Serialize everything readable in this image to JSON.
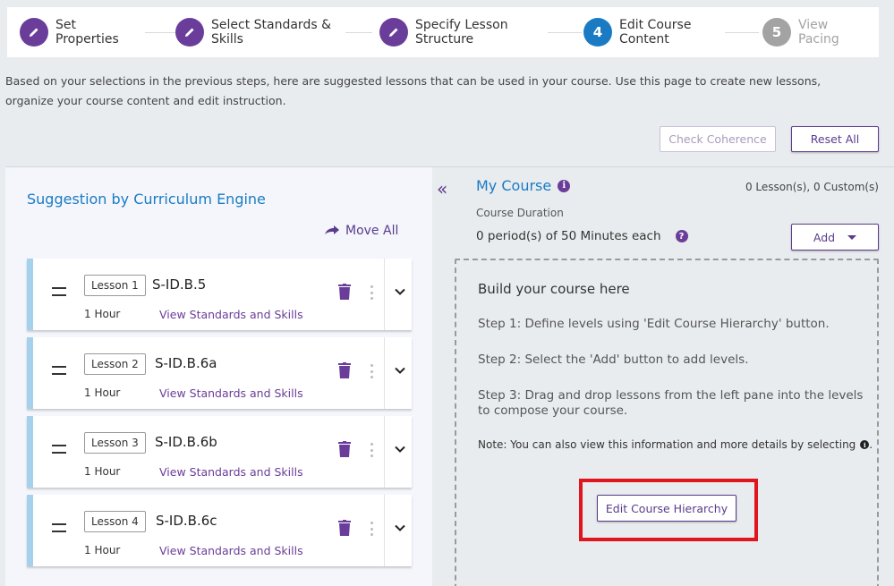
{
  "stepper": {
    "steps": [
      {
        "number": "",
        "label": "Set\nProperties",
        "state": "done"
      },
      {
        "number": "",
        "label": "Select Standards &\nSkills",
        "state": "done"
      },
      {
        "number": "",
        "label": "Specify Lesson\nStructure",
        "state": "done"
      },
      {
        "number": "4",
        "label": "Edit Course\nContent",
        "state": "active"
      },
      {
        "number": "5",
        "label": "View\nPacing",
        "state": "pending"
      }
    ]
  },
  "intro": "Based on your selections in the previous steps, here are suggested lessons that can be used in your course. Use this page to create new lessons, organize your course content and edit instruction.",
  "actions": {
    "check_coherence": "Check Coherence",
    "reset_all": "Reset All"
  },
  "left": {
    "title": "Suggestion by Curriculum Engine",
    "move_all": "Move All",
    "lessons": [
      {
        "tag": "Lesson 1",
        "code": "S-ID.B.5",
        "hours": "1 Hour",
        "link": "View Standards and Skills"
      },
      {
        "tag": "Lesson 2",
        "code": "S-ID.B.6a",
        "hours": "1 Hour",
        "link": "View Standards and Skills"
      },
      {
        "tag": "Lesson 3",
        "code": "S-ID.B.6b",
        "hours": "1 Hour",
        "link": "View Standards and Skills"
      },
      {
        "tag": "Lesson 4",
        "code": "S-ID.B.6c",
        "hours": "1 Hour",
        "link": "View Standards and Skills"
      }
    ]
  },
  "collapse_glyph": "«",
  "right": {
    "title": "My Course",
    "info_glyph": "i",
    "count": "0 Lesson(s), 0 Custom(s)",
    "duration_label": "Course Duration",
    "duration_value": "0 period(s) of 50 Minutes each",
    "help_glyph": "?",
    "add_label": "Add",
    "build_title": "Build your course here",
    "step1": "Step 1: Define levels using 'Edit Course Hierarchy' button.",
    "step2": "Step 2: Select the 'Add' button to add levels.",
    "step3": "Step 3: Drag and drop lessons from the left pane into the levels to compose your course.",
    "note": "Note: You can also view this information and more details by selecting",
    "edit_hierarchy": "Edit Course Hierarchy"
  },
  "colors": {
    "brand_purple": "#6a3d9a",
    "active_blue": "#1a7bc4",
    "highlight_red": "#e0161e",
    "card_accent": "#a6d1ec"
  }
}
